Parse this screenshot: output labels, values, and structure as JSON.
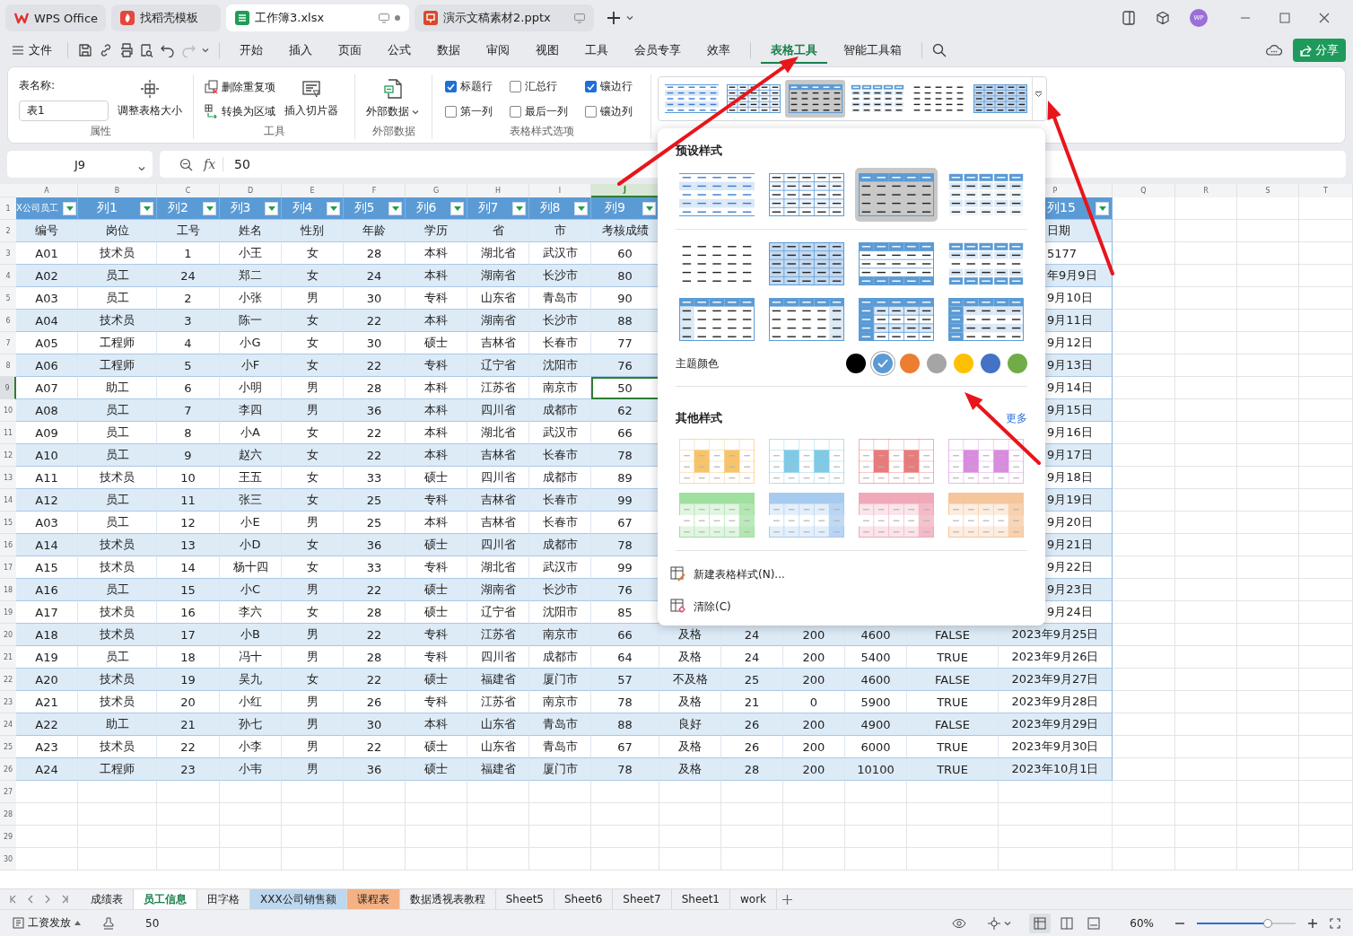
{
  "tabs": [
    {
      "label": "WPS Office",
      "kind": "home",
      "selected": false
    },
    {
      "label": "找稻壳模板",
      "kind": "template",
      "selected": false
    },
    {
      "label": "工作簿3.xlsx",
      "kind": "sheet",
      "selected": true
    },
    {
      "label": "演示文稿素材2.pptx",
      "kind": "slides",
      "selected": false
    }
  ],
  "account": {
    "initials": "WP"
  },
  "menu": {
    "file": "文件",
    "tabs": [
      {
        "label": "开始",
        "selected": false
      },
      {
        "label": "插入",
        "selected": false
      },
      {
        "label": "页面",
        "selected": false
      },
      {
        "label": "公式",
        "selected": false
      },
      {
        "label": "数据",
        "selected": false
      },
      {
        "label": "审阅",
        "selected": false
      },
      {
        "label": "视图",
        "selected": false
      },
      {
        "label": "工具",
        "selected": false
      },
      {
        "label": "会员专享",
        "selected": false
      },
      {
        "label": "效率",
        "selected": false
      }
    ],
    "context_tabs": [
      {
        "label": "表格工具",
        "selected": true
      },
      {
        "label": "智能工具箱",
        "selected": false
      }
    ],
    "share": "分享"
  },
  "ribbon": {
    "properties": {
      "name_label": "表名称:",
      "name_value": "表1",
      "resize": "调整表格大小",
      "title": "属性"
    },
    "tools": {
      "remove_duplicates": "删除重复项",
      "convert": "转换为区域",
      "slicer": "插入切片器",
      "title": "工具"
    },
    "external": {
      "button": "外部数据",
      "title": "外部数据"
    },
    "style_options": {
      "title": "表格样式选项",
      "options": [
        {
          "label": "标题行",
          "checked": true
        },
        {
          "label": "汇总行",
          "checked": false
        },
        {
          "label": "镶边行",
          "checked": true
        },
        {
          "label": "第一列",
          "checked": false
        },
        {
          "label": "最后一列",
          "checked": false
        },
        {
          "label": "镶边列",
          "checked": false
        }
      ]
    },
    "gallery": [
      {
        "kind": "light-banded",
        "selected": false
      },
      {
        "kind": "grid",
        "selected": false
      },
      {
        "kind": "header-banded",
        "selected": true
      },
      {
        "kind": "blocks",
        "selected": false
      },
      {
        "kind": "plain",
        "selected": false
      },
      {
        "kind": "filled-grid",
        "selected": false
      }
    ]
  },
  "formula_bar": {
    "cell": "J9",
    "function_label": "fx",
    "value": "50"
  },
  "sheet": {
    "columns": [
      {
        "letter": "A",
        "selected": false
      },
      {
        "letter": "B",
        "selected": false
      },
      {
        "letter": "C",
        "selected": false
      },
      {
        "letter": "D",
        "selected": false
      },
      {
        "letter": "E",
        "selected": false
      },
      {
        "letter": "F",
        "selected": false
      },
      {
        "letter": "G",
        "selected": false
      },
      {
        "letter": "H",
        "selected": false
      },
      {
        "letter": "I",
        "selected": false
      },
      {
        "letter": "J",
        "selected": true
      },
      {
        "letter": "P",
        "selected": false
      },
      {
        "letter": "Q",
        "selected": false
      },
      {
        "letter": "R",
        "selected": false
      },
      {
        "letter": "S",
        "selected": false
      },
      {
        "letter": "T",
        "selected": false
      }
    ],
    "rows": [
      {
        "number": "1",
        "kind": "title",
        "selected": false,
        "cells": [
          "X公司员工",
          "列1",
          "列2",
          "列3",
          "列4",
          "列5",
          "列6",
          "列7",
          "列8",
          "列9"
        ],
        "column_p": "列15"
      },
      {
        "number": "2",
        "kind": "data",
        "selected": false,
        "cells": [
          "编号",
          "岗位",
          "工号",
          "姓名",
          "性别",
          "年龄",
          "学历",
          "省",
          "市",
          "考核成绩"
        ],
        "column_p": "日期"
      },
      {
        "number": "3",
        "kind": "data",
        "selected": false,
        "cells": [
          "A01",
          "技术员",
          "1",
          "小王",
          "女",
          "28",
          "本科",
          "湖北省",
          "武汉市",
          "60"
        ],
        "column_p": "5177"
      },
      {
        "number": "4",
        "kind": "data",
        "selected": false,
        "cells": [
          "A02",
          "员工",
          "24",
          "郑二",
          "女",
          "24",
          "本科",
          "湖南省",
          "长沙市",
          "80"
        ],
        "column_p": "年9月9日"
      },
      {
        "number": "5",
        "kind": "data",
        "selected": false,
        "cells": [
          "A03",
          "员工",
          "2",
          "小张",
          "男",
          "30",
          "专科",
          "山东省",
          "青岛市",
          "90"
        ],
        "column_p": "9月10日"
      },
      {
        "number": "6",
        "kind": "data",
        "selected": false,
        "cells": [
          "A04",
          "技术员",
          "3",
          "陈一",
          "女",
          "22",
          "本科",
          "湖南省",
          "长沙市",
          "88"
        ],
        "column_p": "9月11日"
      },
      {
        "number": "7",
        "kind": "data",
        "selected": false,
        "cells": [
          "A05",
          "工程师",
          "4",
          "小G",
          "女",
          "30",
          "硕士",
          "吉林省",
          "长春市",
          "77"
        ],
        "column_p": "9月12日"
      },
      {
        "number": "8",
        "kind": "data",
        "selected": false,
        "cells": [
          "A06",
          "工程师",
          "5",
          "小F",
          "女",
          "22",
          "专科",
          "辽宁省",
          "沈阳市",
          "76"
        ],
        "column_p": "9月13日"
      },
      {
        "number": "9",
        "kind": "data",
        "selected": true,
        "cells": [
          "A07",
          "助工",
          "6",
          "小明",
          "男",
          "28",
          "本科",
          "江苏省",
          "南京市",
          "50"
        ],
        "column_p": "9月14日"
      },
      {
        "number": "10",
        "kind": "data",
        "selected": false,
        "cells": [
          "A08",
          "员工",
          "7",
          "李四",
          "男",
          "36",
          "本科",
          "四川省",
          "成都市",
          "62"
        ],
        "column_p": "9月15日"
      },
      {
        "number": "11",
        "kind": "data",
        "selected": false,
        "cells": [
          "A09",
          "员工",
          "8",
          "小A",
          "女",
          "22",
          "本科",
          "湖北省",
          "武汉市",
          "66"
        ],
        "column_p": "9月16日"
      },
      {
        "number": "12",
        "kind": "data",
        "selected": false,
        "cells": [
          "A10",
          "员工",
          "9",
          "赵六",
          "女",
          "22",
          "本科",
          "吉林省",
          "长春市",
          "78"
        ],
        "column_p": "9月17日"
      },
      {
        "number": "13",
        "kind": "data",
        "selected": false,
        "cells": [
          "A11",
          "技术员",
          "10",
          "王五",
          "女",
          "33",
          "硕士",
          "四川省",
          "成都市",
          "89"
        ],
        "column_p": "9月18日"
      },
      {
        "number": "14",
        "kind": "data",
        "selected": false,
        "cells": [
          "A12",
          "员工",
          "11",
          "张三",
          "女",
          "25",
          "专科",
          "吉林省",
          "长春市",
          "99"
        ],
        "column_p": "9月19日"
      },
      {
        "number": "15",
        "kind": "data",
        "selected": false,
        "cells": [
          "A03",
          "员工",
          "12",
          "小E",
          "男",
          "25",
          "本科",
          "吉林省",
          "长春市",
          "67"
        ],
        "column_p": "9月20日"
      },
      {
        "number": "16",
        "kind": "data",
        "selected": false,
        "cells": [
          "A14",
          "技术员",
          "13",
          "小D",
          "女",
          "36",
          "硕士",
          "四川省",
          "成都市",
          "78"
        ],
        "column_p": "9月21日"
      },
      {
        "number": "17",
        "kind": "data",
        "selected": false,
        "cells": [
          "A15",
          "技术员",
          "14",
          "杨十四",
          "女",
          "33",
          "专科",
          "湖北省",
          "武汉市",
          "99"
        ],
        "column_p": "9月22日"
      },
      {
        "number": "18",
        "kind": "data",
        "selected": false,
        "cells": [
          "A16",
          "员工",
          "15",
          "小C",
          "男",
          "22",
          "硕士",
          "湖南省",
          "长沙市",
          "76"
        ],
        "column_p": "9月23日"
      },
      {
        "number": "19",
        "kind": "data",
        "selected": false,
        "cells": [
          "A17",
          "技术员",
          "16",
          "李六",
          "女",
          "28",
          "硕士",
          "辽宁省",
          "沈阳市",
          "85"
        ],
        "column_p": "9月24日"
      },
      {
        "number": "20",
        "kind": "data",
        "selected": false,
        "cells": [
          "A18",
          "技术员",
          "17",
          "小B",
          "男",
          "22",
          "专科",
          "江苏省",
          "南京市",
          "66",
          "及格",
          "24",
          "200",
          "4600",
          "FALSE",
          "2023年9月25日"
        ]
      },
      {
        "number": "21",
        "kind": "data",
        "selected": false,
        "cells": [
          "A19",
          "员工",
          "18",
          "冯十",
          "男",
          "28",
          "专科",
          "四川省",
          "成都市",
          "64",
          "及格",
          "24",
          "200",
          "5400",
          "TRUE",
          "2023年9月26日"
        ]
      },
      {
        "number": "22",
        "kind": "data",
        "selected": false,
        "cells": [
          "A20",
          "技术员",
          "19",
          "吴九",
          "女",
          "22",
          "硕士",
          "福建省",
          "厦门市",
          "57",
          "不及格",
          "25",
          "200",
          "4600",
          "FALSE",
          "2023年9月27日"
        ]
      },
      {
        "number": "23",
        "kind": "data",
        "selected": false,
        "cells": [
          "A21",
          "技术员",
          "20",
          "小红",
          "男",
          "26",
          "专科",
          "江苏省",
          "南京市",
          "78",
          "及格",
          "21",
          "0",
          "5900",
          "TRUE",
          "2023年9月28日"
        ]
      },
      {
        "number": "24",
        "kind": "data",
        "selected": false,
        "cells": [
          "A22",
          "助工",
          "21",
          "孙七",
          "男",
          "30",
          "本科",
          "山东省",
          "青岛市",
          "88",
          "良好",
          "26",
          "200",
          "4900",
          "FALSE",
          "2023年9月29日"
        ]
      },
      {
        "number": "25",
        "kind": "data",
        "selected": false,
        "cells": [
          "A23",
          "技术员",
          "22",
          "小李",
          "男",
          "22",
          "硕士",
          "山东省",
          "青岛市",
          "67",
          "及格",
          "26",
          "200",
          "6000",
          "TRUE",
          "2023年9月30日"
        ]
      },
      {
        "number": "26",
        "kind": "data",
        "selected": false,
        "cells": [
          "A24",
          "工程师",
          "23",
          "小韦",
          "男",
          "36",
          "硕士",
          "福建省",
          "厦门市",
          "78",
          "及格",
          "28",
          "200",
          "10100",
          "TRUE",
          "2023年10月1日"
        ]
      },
      {
        "number": "27",
        "kind": "empty",
        "selected": false
      },
      {
        "number": "28",
        "kind": "empty",
        "selected": false
      },
      {
        "number": "29",
        "kind": "empty",
        "selected": false
      },
      {
        "number": "30",
        "kind": "empty",
        "selected": false
      }
    ]
  },
  "popup": {
    "preset_title": "预设样式",
    "presets": [
      {
        "kind": "light-banded",
        "selected": false
      },
      {
        "kind": "grid",
        "selected": false
      },
      {
        "kind": "header-banded",
        "selected": true
      },
      {
        "kind": "blocks",
        "selected": false
      },
      {
        "kind": "plain",
        "selected": false
      },
      {
        "kind": "filled-grid",
        "selected": false
      },
      {
        "kind": "header-footer",
        "selected": false
      },
      {
        "kind": "blocks-footer",
        "selected": false
      },
      {
        "kind": "header-first-column",
        "selected": false
      },
      {
        "kind": "header-last-column",
        "selected": false
      },
      {
        "kind": "column-blocks",
        "selected": false
      },
      {
        "kind": "first-column-header",
        "selected": false
      }
    ],
    "theme_label": "主题颜色",
    "theme_colors": [
      {
        "color": "#000000",
        "selected": false
      },
      {
        "color": "#5b9bd5",
        "selected": true
      },
      {
        "color": "#ed7d31",
        "selected": false
      },
      {
        "color": "#a5a5a5",
        "selected": false
      },
      {
        "color": "#ffc000",
        "selected": false
      },
      {
        "color": "#4472c4",
        "selected": false
      },
      {
        "color": "#70ad47",
        "selected": false
      }
    ],
    "other_title": "其他样式",
    "more": "更多",
    "others": [
      {
        "kind": "columns",
        "color": "#f7c46c"
      },
      {
        "kind": "columns",
        "color": "#7fcae6"
      },
      {
        "kind": "columns",
        "color": "#e87b7b"
      },
      {
        "kind": "columns",
        "color": "#d98be0"
      },
      {
        "kind": "banded",
        "color": "#9fdf9f"
      },
      {
        "kind": "banded",
        "color": "#a7cbef"
      },
      {
        "kind": "banded",
        "color": "#f0a9b9"
      },
      {
        "kind": "banded",
        "color": "#f5c59b"
      }
    ],
    "actions": [
      {
        "label": "新建表格样式(N)...",
        "kind": "new"
      },
      {
        "label": "清除(C)",
        "kind": "clear"
      }
    ]
  },
  "sheet_tabs": [
    {
      "label": "成绩表",
      "selected": false
    },
    {
      "label": "员工信息",
      "selected": true
    },
    {
      "label": "田字格",
      "selected": false
    },
    {
      "label": "XXX公司销售额",
      "selected": false,
      "color": "#bdd7ee"
    },
    {
      "label": "课程表",
      "selected": false,
      "color": "#f4b183"
    },
    {
      "label": "数据透视表教程",
      "selected": false
    },
    {
      "label": "Sheet5",
      "selected": false
    },
    {
      "label": "Sheet6",
      "selected": false
    },
    {
      "label": "Sheet7",
      "selected": false
    },
    {
      "label": "Sheet1",
      "selected": false
    },
    {
      "label": "work",
      "selected": false
    }
  ],
  "status_bar": {
    "macro": "工资发放",
    "value": "50",
    "zoom": "60%",
    "level": 0.72,
    "views": [
      {
        "kind": "normal",
        "selected": true
      },
      {
        "kind": "page-break",
        "selected": false
      },
      {
        "kind": "page-layout",
        "selected": false
      }
    ]
  }
}
